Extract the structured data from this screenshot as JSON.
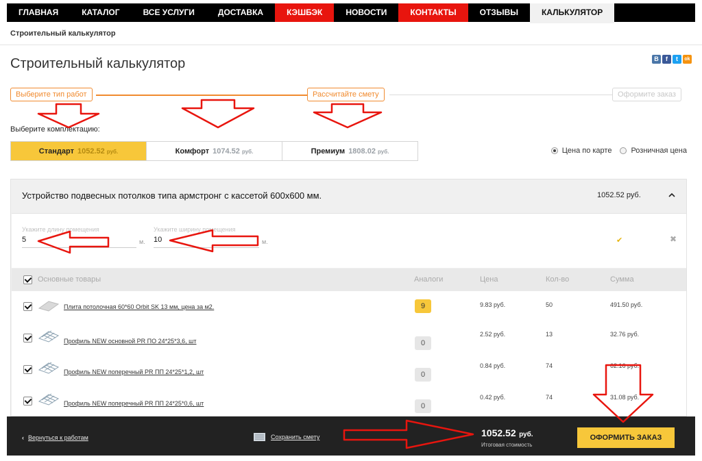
{
  "nav": {
    "items": [
      {
        "label": "ГЛАВНАЯ"
      },
      {
        "label": "КАТАЛОГ"
      },
      {
        "label": "ВСЕ УСЛУГИ"
      },
      {
        "label": "ДОСТАВКА"
      },
      {
        "label": "КЭШБЭК"
      },
      {
        "label": "НОВОСТИ"
      },
      {
        "label": "КОНТАКТЫ"
      },
      {
        "label": "ОТЗЫВЫ"
      },
      {
        "label": "КАЛЬКУЛЯТОР"
      }
    ]
  },
  "breadcrumb": "Строительный калькулятор",
  "page_title": "Строительный калькулятор",
  "share": {
    "vk": "B",
    "fb": "f",
    "tw": "t",
    "ok": "ok"
  },
  "steps": [
    {
      "label": "Выберите тип работ"
    },
    {
      "label": "Рассчитайте смету"
    },
    {
      "label": "Оформите заказ"
    }
  ],
  "choose_label": "Выберите комплектацию:",
  "packages": [
    {
      "name": "Стандарт",
      "price": "1052.52",
      "currency": "руб."
    },
    {
      "name": "Комфорт",
      "price": "1074.52",
      "currency": "руб."
    },
    {
      "name": "Премиум",
      "price": "1808.02",
      "currency": "руб."
    }
  ],
  "price_options": {
    "card": "Цена по карте",
    "retail": "Розничная цена"
  },
  "work": {
    "title": "Устройство подвесных потолков типа армстронг с кассетой 600х600 мм.",
    "sum": "1052.52 руб."
  },
  "fields": {
    "length": {
      "label": "Укажите длину помещения",
      "value": "5",
      "unit": "м."
    },
    "width": {
      "label": "Укажите ширину помещения",
      "value": "10",
      "unit": "м."
    }
  },
  "marks": {
    "ok": "✔",
    "remove": "✖"
  },
  "table": {
    "headers": {
      "products": "Основные товары",
      "analogs": "Аналоги",
      "price": "Цена",
      "qty": "Кол-во",
      "sum": "Сумма"
    },
    "rows": [
      {
        "name": "Плита потолочная 60*60 Orbit SK 13 мм, цена за м2.",
        "analogs": "9",
        "price": "9.83 руб.",
        "qty": "50",
        "sum": "491.50 руб."
      },
      {
        "name": "Профиль NEW основной PR ПО 24*25*3,6, шт",
        "analogs": "0",
        "price": "2.52 руб.",
        "qty": "13",
        "sum": "32.76 руб."
      },
      {
        "name": "Профиль NEW поперечный PR ПП 24*25*1,2, шт",
        "analogs": "0",
        "price": "0.84 руб.",
        "qty": "74",
        "sum": "62.16 руб."
      },
      {
        "name": "Профиль NEW поперечный PR ПП 24*25*0,6, шт",
        "analogs": "0",
        "price": "0.42 руб.",
        "qty": "74",
        "sum": "31.08 руб."
      }
    ]
  },
  "bottom": {
    "back": "Вернуться к работам",
    "save": "Сохранить смету",
    "total_value": "1052.52",
    "total_currency": "руб.",
    "total_caption": "Итоговая стоимость",
    "order": "ОФОРМИТЬ ЗАКАЗ"
  },
  "colors": {
    "accent": "#f7c73a",
    "red": "#e8150e",
    "step": "#f08a2e",
    "annotation": "#e8150e"
  }
}
